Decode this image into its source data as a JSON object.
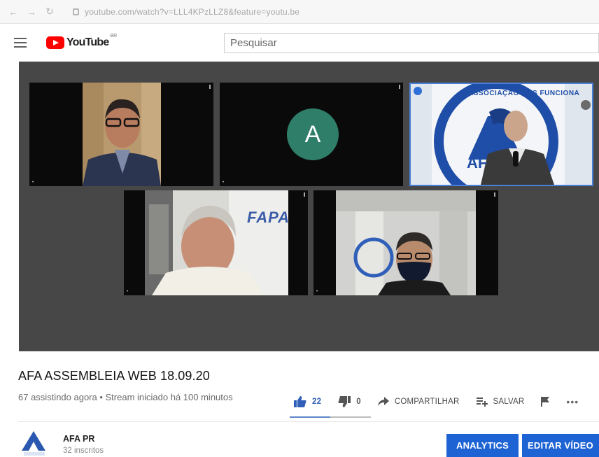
{
  "browser": {
    "back_icon": "arrow-left-icon",
    "forward_icon": "arrow-right-icon",
    "reload_icon": "reload-icon",
    "url": "youtube.com/watch?v=LLL4KPzLLZ8&feature=youtu.be"
  },
  "header": {
    "logo_text": "YouTube",
    "country_code": "BR",
    "search_placeholder": "Pesquisar"
  },
  "player": {
    "participants": [
      {
        "initial": ""
      },
      {
        "initial": "A"
      },
      {
        "initial": ""
      },
      {
        "initial": ""
      },
      {
        "initial": ""
      }
    ],
    "wall_text_tile3": "ASSOCIAÇÃO DOS FUNCIONÁRIOS DO INSTITUTO",
    "wall_text_tile3_short": "AF",
    "wall_text_tile4": "FAPA"
  },
  "video": {
    "title": "AFA ASSEMBLEIA WEB 18.09.20",
    "stats": "67 assistindo agora • Stream iniciado há 100 minutos"
  },
  "actions": {
    "likes": "22",
    "dislikes": "0",
    "share_label": "COMPARTILHAR",
    "save_label": "SALVAR",
    "like_ratio": 0.5
  },
  "channel": {
    "name": "AFA PR",
    "subscribers": "32 inscritos",
    "logo_text": "AFA PR"
  },
  "buttons": {
    "analytics": "ANALYTICS",
    "edit_video": "EDITAR VÍDEO"
  },
  "colors": {
    "accent": "#1e63d4",
    "like_blue": "#2f5fb8",
    "player_bg": "#474747",
    "avatar_green": "#2f7e6a"
  }
}
